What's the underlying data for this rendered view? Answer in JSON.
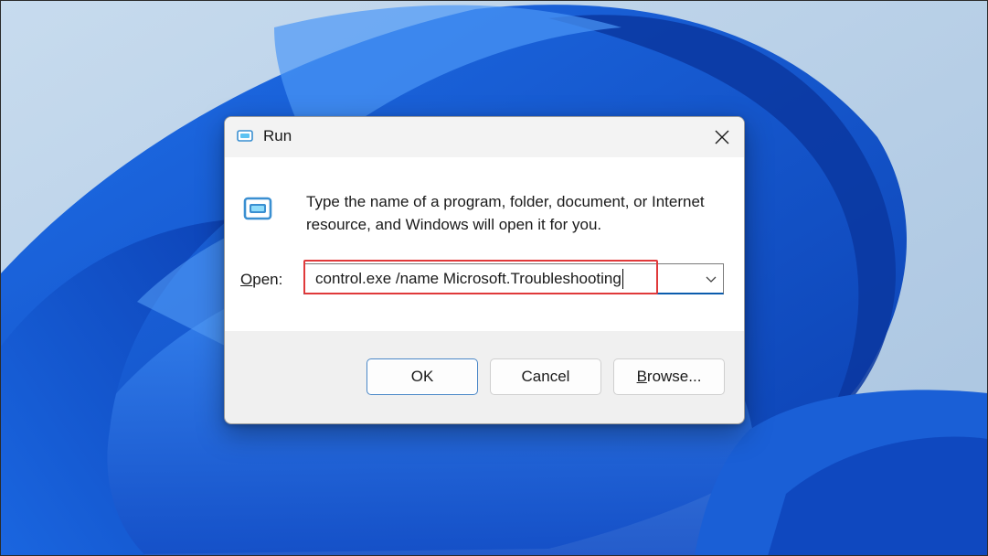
{
  "dialog": {
    "title": "Run",
    "description": "Type the name of a program, folder, document, or Internet resource, and Windows will open it for you.",
    "open_label": "Open:",
    "open_label_access": "O",
    "open_label_rest": "pen:",
    "input_value": "control.exe /name Microsoft.Troubleshooting",
    "buttons": {
      "ok": "OK",
      "cancel": "Cancel",
      "browse_access": "B",
      "browse_rest": "rowse..."
    },
    "icons": {
      "title": "run-app-icon",
      "main": "run-app-icon",
      "close": "close-icon",
      "dropdown": "chevron-down-icon"
    }
  },
  "colors": {
    "highlight": "#e0393a",
    "input_focus": "#0b5cad",
    "wallpaper_accent": "#1a5fd6"
  }
}
